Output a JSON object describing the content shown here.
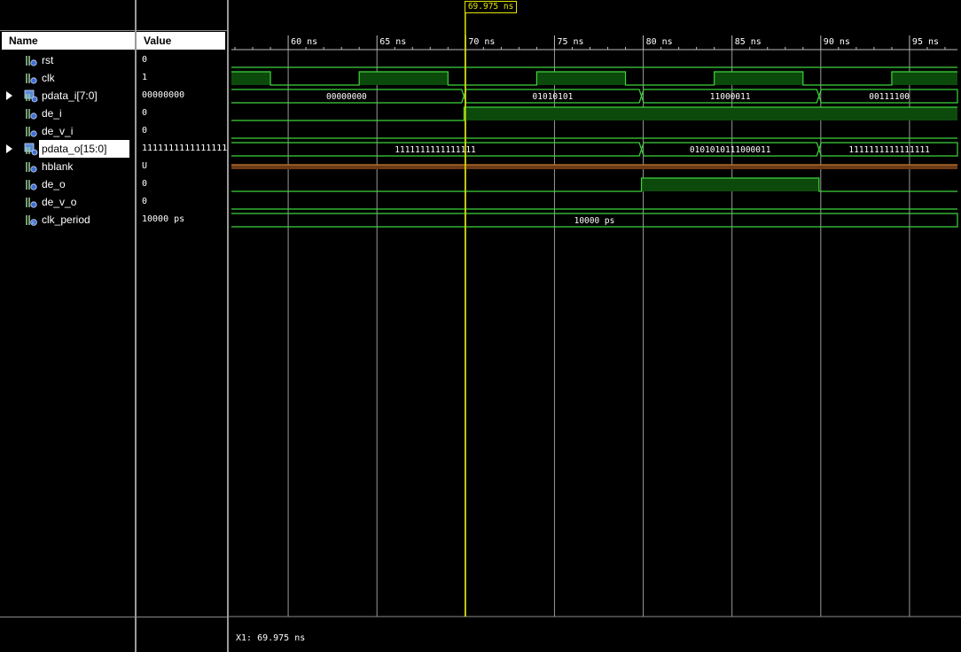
{
  "columns": {
    "name": "Name",
    "value": "Value"
  },
  "signals": [
    {
      "name": "rst",
      "value": "0",
      "icon": "scalar-signal-icon",
      "expandable": false,
      "selected": false
    },
    {
      "name": "clk",
      "value": "1",
      "icon": "scalar-signal-icon",
      "expandable": false,
      "selected": false
    },
    {
      "name": "pdata_i[7:0]",
      "value": "00000000",
      "icon": "bus-signal-icon",
      "expandable": true,
      "selected": false
    },
    {
      "name": "de_i",
      "value": "0",
      "icon": "scalar-signal-icon",
      "expandable": false,
      "selected": false
    },
    {
      "name": "de_v_i",
      "value": "0",
      "icon": "scalar-signal-icon",
      "expandable": false,
      "selected": false
    },
    {
      "name": "pdata_o[15:0]",
      "value": "1111111111111111",
      "icon": "bus-signal-icon",
      "expandable": true,
      "selected": true
    },
    {
      "name": "hblank",
      "value": "U",
      "icon": "scalar-signal-icon",
      "expandable": false,
      "selected": false
    },
    {
      "name": "de_o",
      "value": "0",
      "icon": "scalar-signal-icon",
      "expandable": false,
      "selected": false
    },
    {
      "name": "de_v_o",
      "value": "0",
      "icon": "scalar-signal-icon",
      "expandable": false,
      "selected": false
    },
    {
      "name": "clk_period",
      "value": "10000 ps",
      "icon": "constant-signal-icon",
      "expandable": false,
      "selected": false
    }
  ],
  "timeline": {
    "start_ns": 56.8,
    "end_ns": 97.7,
    "ticks": [
      {
        "t": 60,
        "label": "60 ns"
      },
      {
        "t": 65,
        "label": "65 ns"
      },
      {
        "t": 70,
        "label": "70 ns"
      },
      {
        "t": 75,
        "label": "75 ns"
      },
      {
        "t": 80,
        "label": "80 ns"
      },
      {
        "t": 85,
        "label": "85 ns"
      },
      {
        "t": 90,
        "label": "90 ns"
      },
      {
        "t": 95,
        "label": "95 ns"
      }
    ]
  },
  "cursor": {
    "t": 69.975,
    "label": "69.975 ns"
  },
  "status": {
    "readout": "X1: 69.975 ns"
  },
  "waves": {
    "rst": {
      "kind": "bit",
      "segments": [
        {
          "from": 56.8,
          "to": 97.7,
          "v": 0
        }
      ]
    },
    "clk": {
      "kind": "bit",
      "segments": [
        {
          "from": 56.8,
          "to": 59,
          "v": 1
        },
        {
          "from": 59,
          "to": 64,
          "v": 0
        },
        {
          "from": 64,
          "to": 69,
          "v": 1
        },
        {
          "from": 69,
          "to": 74,
          "v": 0
        },
        {
          "from": 74,
          "to": 79,
          "v": 1
        },
        {
          "from": 79,
          "to": 84,
          "v": 0
        },
        {
          "from": 84,
          "to": 89,
          "v": 1
        },
        {
          "from": 89,
          "to": 94,
          "v": 0
        },
        {
          "from": 94,
          "to": 97.7,
          "v": 1
        }
      ]
    },
    "pdata_i": {
      "kind": "bus",
      "segments": [
        {
          "from": 56.8,
          "to": 69.9,
          "label": "00000000"
        },
        {
          "from": 69.9,
          "to": 79.9,
          "label": "01010101"
        },
        {
          "from": 79.9,
          "to": 89.9,
          "label": "11000011"
        },
        {
          "from": 89.9,
          "to": 97.7,
          "label": "00111100"
        }
      ]
    },
    "de_i": {
      "kind": "bit",
      "segments": [
        {
          "from": 56.8,
          "to": 69.9,
          "v": 0
        },
        {
          "from": 69.9,
          "to": 97.7,
          "v": 1
        }
      ]
    },
    "de_v_i": {
      "kind": "bit",
      "segments": [
        {
          "from": 56.8,
          "to": 97.7,
          "v": 0
        }
      ]
    },
    "pdata_o": {
      "kind": "bus",
      "segments": [
        {
          "from": 56.8,
          "to": 79.9,
          "label": "1111111111111111"
        },
        {
          "from": 79.9,
          "to": 89.9,
          "label": "0101010111000011"
        },
        {
          "from": 89.9,
          "to": 97.7,
          "label": "1111111111111111"
        }
      ]
    },
    "hblank": {
      "kind": "undefined",
      "segments": [
        {
          "from": 56.8,
          "to": 97.7
        }
      ]
    },
    "de_o": {
      "kind": "bit",
      "segments": [
        {
          "from": 56.8,
          "to": 79.9,
          "v": 0
        },
        {
          "from": 79.9,
          "to": 89.9,
          "v": 1
        },
        {
          "from": 89.9,
          "to": 97.7,
          "v": 0
        }
      ]
    },
    "de_v_o": {
      "kind": "bit",
      "segments": [
        {
          "from": 56.8,
          "to": 97.7,
          "v": 0
        }
      ]
    },
    "clk_period": {
      "kind": "bus",
      "segments": [
        {
          "from": 56.8,
          "to": 97.7,
          "label": "10000 ps"
        }
      ]
    }
  },
  "colors": {
    "wave": "#3cd43c",
    "high_fill": "#0c4a0c",
    "undefined_fill": "#6b3a16",
    "undefined_line": "#c87832",
    "cursor": "#e6e600",
    "grid": "#9a9a9a"
  }
}
